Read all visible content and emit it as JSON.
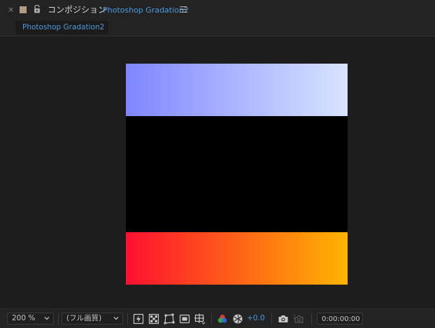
{
  "panel": {
    "close_glyph": "×",
    "label_color": "#b29a85",
    "title": "コンポジション",
    "comp_name": "Photoshop Gradation2",
    "icons": [
      "close-icon",
      "label-color-swatch",
      "lock-icon",
      "panel-menu-icon"
    ]
  },
  "tabs": [
    {
      "label": "Photoshop Gradation2",
      "active": true
    }
  ],
  "canvas": {
    "top_gradient": {
      "from": "#7f86ff",
      "to": "#d8e4ff"
    },
    "middle_fill": "#000000",
    "bottom_gradient": {
      "from": "#ff1030",
      "to": "#ffb400"
    }
  },
  "toolbar": {
    "zoom": "200 %",
    "resolution": "(フル画質)",
    "exposure": "+0.0",
    "timecode": "0:00:00:00",
    "icons": [
      "fast-preview-icon",
      "transparency-grid-icon",
      "mask-path-visibility-icon",
      "region-of-interest-icon",
      "grid-guides-icon",
      "color-channels-icon",
      "reset-exposure-icon",
      "snapshot-camera-icon",
      "show-snapshot-icon"
    ]
  },
  "colors": {
    "accent": "#4a9bdf",
    "panel_bg": "#232323",
    "viewer_bg": "#1d1d1d"
  }
}
